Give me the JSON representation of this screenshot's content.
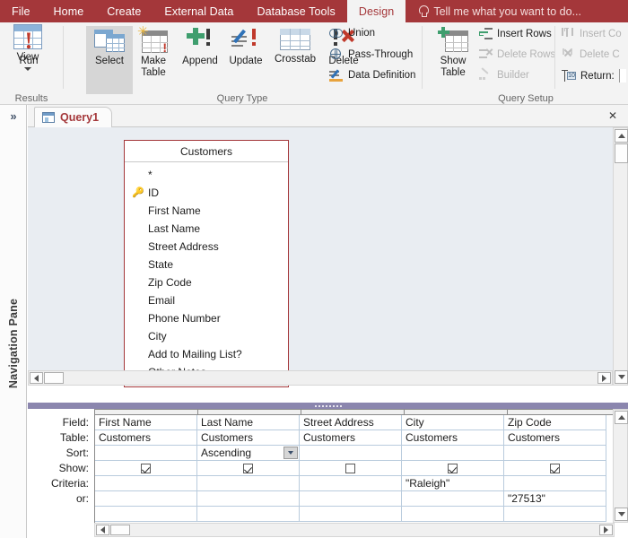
{
  "ribbon": {
    "tabs": [
      {
        "label": "File",
        "active": false
      },
      {
        "label": "Home",
        "active": false
      },
      {
        "label": "Create",
        "active": false
      },
      {
        "label": "External Data",
        "active": false
      },
      {
        "label": "Database Tools",
        "active": false
      },
      {
        "label": "Design",
        "active": true
      }
    ],
    "tellme": {
      "label": "Tell me what you want to do...",
      "icon": "lightbulb-icon"
    },
    "groups": [
      {
        "name": "Results",
        "label": "Results"
      },
      {
        "name": "QueryType",
        "label": "Query Type"
      },
      {
        "name": "QuerySetup",
        "label": "Query Setup"
      }
    ],
    "results": {
      "view": "View",
      "run": "Run"
    },
    "query_type": {
      "select": "Select",
      "make_table": "Make Table",
      "append": "Append",
      "update": "Update",
      "crosstab": "Crosstab",
      "delete": "Delete",
      "union": "Union",
      "pass_through": "Pass-Through",
      "data_definition": "Data Definition"
    },
    "query_setup": {
      "show_table": "Show Table",
      "insert_rows": "Insert Rows",
      "delete_rows": "Delete Rows",
      "builder": "Builder",
      "insert_columns": "Insert Co",
      "delete_columns": "Delete C",
      "return": "Return:"
    },
    "colors": {
      "accent": "#a4373a",
      "ribbon_bg": "#f3f3f3"
    }
  },
  "navigation_pane": {
    "label": "Navigation Pane",
    "expand_icon": "»"
  },
  "document_tab": {
    "label": "Query1",
    "close_label": "✕"
  },
  "design_surface": {
    "table": {
      "title": "Customers",
      "fields": [
        {
          "label": "*",
          "key": false,
          "star": true
        },
        {
          "label": "ID",
          "key": true,
          "star": false
        },
        {
          "label": "First Name",
          "key": false,
          "star": false
        },
        {
          "label": "Last Name",
          "key": false,
          "star": false
        },
        {
          "label": "Street Address",
          "key": false,
          "star": false
        },
        {
          "label": "State",
          "key": false,
          "star": false
        },
        {
          "label": "Zip Code",
          "key": false,
          "star": false
        },
        {
          "label": "Email",
          "key": false,
          "star": false
        },
        {
          "label": "Phone Number",
          "key": false,
          "star": false
        },
        {
          "label": "City",
          "key": false,
          "star": false
        },
        {
          "label": "Add to Mailing List?",
          "key": false,
          "star": false
        },
        {
          "label": "Other Notes",
          "key": false,
          "star": false
        }
      ]
    }
  },
  "query_grid": {
    "row_labels": [
      "Field:",
      "Table:",
      "Sort:",
      "Show:",
      "Criteria:",
      "or:"
    ],
    "columns": [
      {
        "field": "First Name",
        "table": "Customers",
        "sort": "",
        "show": true,
        "criteria": "",
        "or": ""
      },
      {
        "field": "Last Name",
        "table": "Customers",
        "sort": "Ascending",
        "show": true,
        "criteria": "",
        "or": ""
      },
      {
        "field": "Street Address",
        "table": "Customers",
        "sort": "",
        "show": false,
        "criteria": "",
        "or": ""
      },
      {
        "field": "City",
        "table": "Customers",
        "sort": "",
        "show": true,
        "criteria": "\"Raleigh\"",
        "or": ""
      },
      {
        "field": "Zip Code",
        "table": "Customers",
        "sort": "",
        "show": true,
        "criteria": "",
        "or": "\"27513\""
      }
    ]
  }
}
